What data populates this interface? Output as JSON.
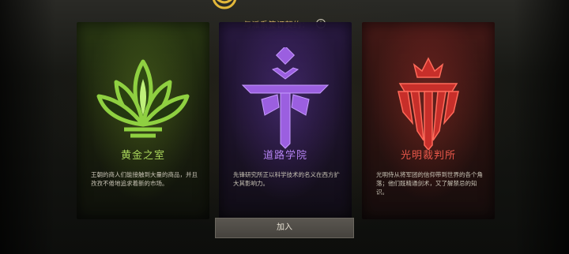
{
  "header": {
    "title": "与派系签订契约：",
    "info_icon": "info-icon"
  },
  "factions": [
    {
      "name": "黄金之室",
      "description": "王朝的商人们能接触到大量的商品，并且孜孜不倦地追求着新的市场。",
      "icon": "lotus-icon",
      "accent_color": "#a8d45a"
    },
    {
      "name": "道路学院",
      "description": "先锋研究所正以科学技术的名义在西方扩大其影响力。",
      "icon": "path-academy-icon",
      "accent_color": "#b583f2"
    },
    {
      "name": "光明裁判所",
      "description": "光明侍从将军团的信仰带到世界的各个角落；他们既精通剑术，又了解禁忌的知识。",
      "icon": "crown-sword-icon",
      "accent_color": "#e8574a"
    }
  ],
  "join_button": {
    "label": "加入"
  }
}
